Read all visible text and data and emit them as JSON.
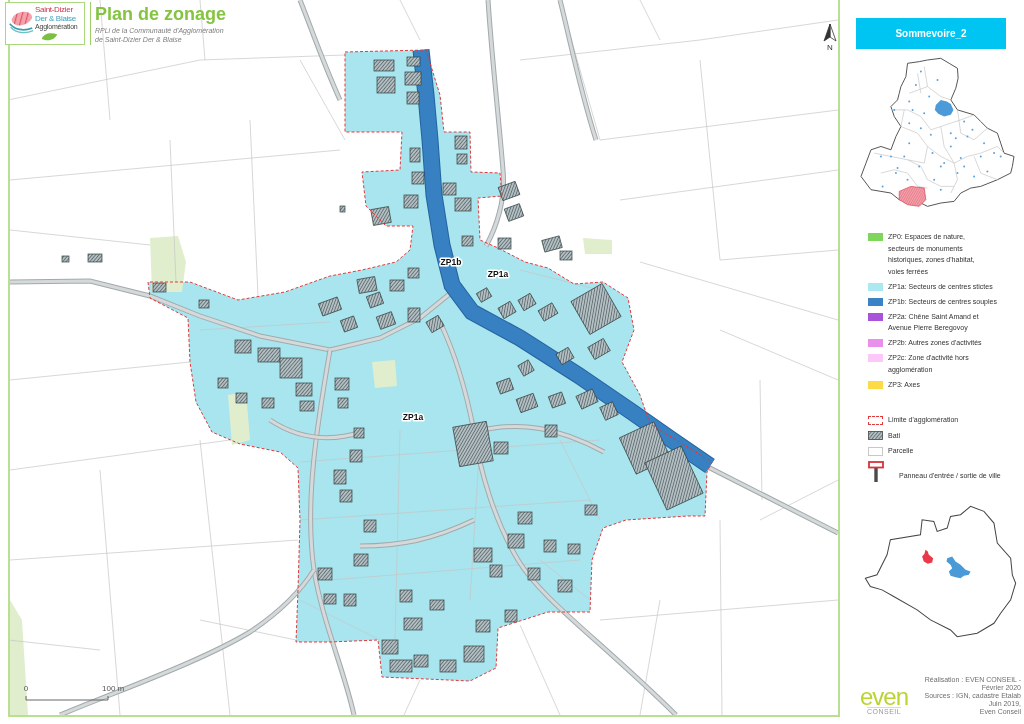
{
  "header": {
    "logo": {
      "line_1": "Saint-Dizier",
      "line_2": "Der & Blaise",
      "tagline": "Agglomération"
    },
    "title": "Plan de zonage",
    "subtitle": "RPLi de la Communauté d'Agglomération\nde Saint-Dizier Der & Blaise"
  },
  "map": {
    "zone_labels": [
      {
        "text": "ZP1b"
      },
      {
        "text": "ZP1a"
      },
      {
        "text": "ZP1a"
      }
    ],
    "north_label": "N",
    "scale_bar": {
      "start": "0",
      "end": "100 m"
    }
  },
  "panel": {
    "location_title": "Sommevoire_2",
    "legend": {
      "zones": [
        {
          "label": "ZP0: Espaces de nature,\nsecteurs de monuments\nhistoriques, zones d'habitat,\nvoies ferrées",
          "color": "#7ed65a"
        },
        {
          "label": "ZP1a: Secteurs de centres stictes",
          "color": "#ace8f1"
        },
        {
          "label": "ZP1b: Secteurs de centres souples",
          "color": "#3a84c6"
        },
        {
          "label": "ZP2a: Chêne Saint Amand et\nAvenue Pierre Beregovoy",
          "color": "#a954d8"
        },
        {
          "label": "ZP2b: Autres zones d'activités",
          "color": "#e98fec"
        },
        {
          "label": "ZP2c: Zone d'activité hors\nagglomération",
          "color": "#fcc8f7"
        },
        {
          "label": "ZP3: Axes",
          "color": "#fcdc46"
        }
      ],
      "symbols": [
        {
          "kind": "dashed-outline",
          "label": "Limite d'agglomération"
        },
        {
          "kind": "hatched",
          "label": "Bati"
        },
        {
          "kind": "outline",
          "label": "Parcelle"
        },
        {
          "kind": "sign",
          "label": "Panneau d'entrée / sortie de ville"
        }
      ]
    },
    "footer": {
      "logo_text": "even",
      "logo_subtext": "CONSEIL",
      "credits": [
        "Réalisation : EVEN CONSEIL - Février 2020",
        "Sources : IGN, cadastre Etalab Juin 2019,",
        "Even Conseil"
      ]
    }
  }
}
